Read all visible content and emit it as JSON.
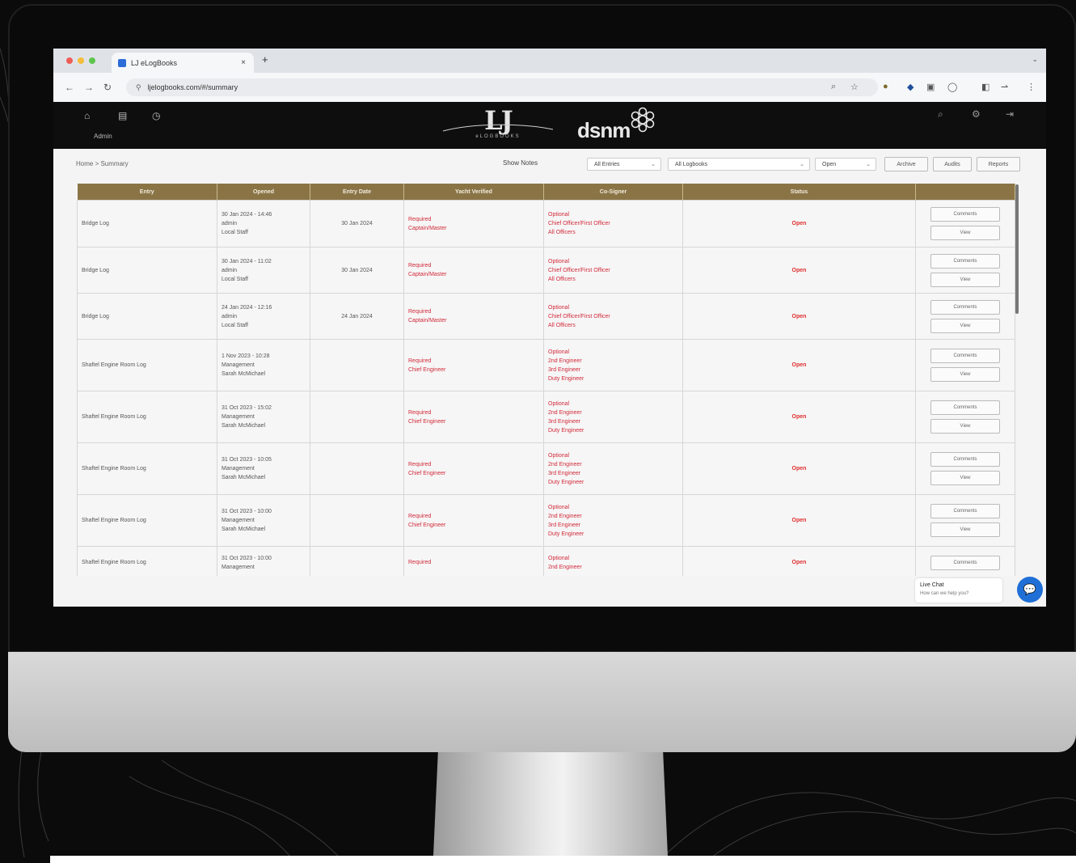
{
  "browser": {
    "tab_title": "LJ eLogBooks",
    "url": "ljelogbooks.com/#/summary"
  },
  "header": {
    "admin_label": "Admin",
    "logo_lj_sub": "eLOGBOOKS",
    "logo_dsnm": "dsnm"
  },
  "toolbar": {
    "breadcrumb": "Home > Summary",
    "show_notes": "Show Notes",
    "filter_entries": "All Entries",
    "filter_logbooks": "All Logbooks",
    "filter_status": "Open",
    "btn_archive": "Archive",
    "btn_audits": "Audits",
    "btn_reports": "Reports"
  },
  "table": {
    "headers": [
      "Entry",
      "Opened",
      "Entry Date",
      "Yacht Verified",
      "Co-Signer",
      "Status",
      ""
    ],
    "rows": [
      {
        "entry": "Bridge Log",
        "opened": [
          "30 Jan 2024 - 14:46",
          "admin",
          "Local Staff"
        ],
        "date": "30 Jan 2024",
        "verified": [
          "Required",
          "Captain/Master"
        ],
        "cosign": [
          "Optional",
          "Chief Officer/First Officer",
          "All Officers"
        ],
        "status": "Open",
        "btn1": "Comments",
        "btn2": "View"
      },
      {
        "entry": "Bridge Log",
        "opened": [
          "30 Jan 2024 - 11:02",
          "admin",
          "Local Staff"
        ],
        "date": "30 Jan 2024",
        "verified": [
          "Required",
          "Captain/Master"
        ],
        "cosign": [
          "Optional",
          "Chief Officer/First Officer",
          "All Officers"
        ],
        "status": "Open",
        "btn1": "Comments",
        "btn2": "View"
      },
      {
        "entry": "Bridge Log",
        "opened": [
          "24 Jan 2024 - 12:16",
          "admin",
          "Local Staff"
        ],
        "date": "24 Jan 2024",
        "verified": [
          "Required",
          "Captain/Master"
        ],
        "cosign": [
          "Optional",
          "Chief Officer/First Officer",
          "All Officers"
        ],
        "status": "Open",
        "btn1": "Comments",
        "btn2": "View"
      },
      {
        "entry": "Shaftel Engine Room Log",
        "opened": [
          "1 Nov 2023 - 10:28",
          "Management",
          "Sarah McMichael"
        ],
        "date": "",
        "verified": [
          "Required",
          "Chief Engineer"
        ],
        "cosign": [
          "Optional",
          "2nd Engineer",
          "3rd Engineer",
          "Duty Engineer"
        ],
        "status": "Open",
        "btn1": "Comments",
        "btn2": "View"
      },
      {
        "entry": "Shaftel Engine Room Log",
        "opened": [
          "31 Oct 2023 - 15:02",
          "Management",
          "Sarah McMichael"
        ],
        "date": "",
        "verified": [
          "Required",
          "Chief Engineer"
        ],
        "cosign": [
          "Optional",
          "2nd Engineer",
          "3rd Engineer",
          "Duty Engineer"
        ],
        "status": "Open",
        "btn1": "Comments",
        "btn2": "View"
      },
      {
        "entry": "Shaftel Engine Room Log",
        "opened": [
          "31 Oct 2023 - 10:05",
          "Management",
          "Sarah McMichael"
        ],
        "date": "",
        "verified": [
          "Required",
          "Chief Engineer"
        ],
        "cosign": [
          "Optional",
          "2nd Engineer",
          "3rd Engineer",
          "Duty Engineer"
        ],
        "status": "Open",
        "btn1": "Comments",
        "btn2": "View"
      },
      {
        "entry": "Shaftel Engine Room Log",
        "opened": [
          "31 Oct 2023 - 10:00",
          "Management",
          "Sarah McMichael"
        ],
        "date": "",
        "verified": [
          "Required",
          "Chief Engineer"
        ],
        "cosign": [
          "Optional",
          "2nd Engineer",
          "3rd Engineer",
          "Duty Engineer"
        ],
        "status": "Open",
        "btn1": "Comments",
        "btn2": "View"
      },
      {
        "entry": "Shaftel Engine Room Log",
        "opened": [
          "31 Oct 2023 - 10:00",
          "Management"
        ],
        "date": "",
        "verified": [
          "Required"
        ],
        "cosign": [
          "Optional",
          "2nd Engineer"
        ],
        "status": "Open",
        "btn1": "Comments",
        "btn2": ""
      }
    ]
  },
  "chat": {
    "title": "Live Chat",
    "subtitle": "How can we help you?"
  },
  "colors": {
    "header_gold": "#8a7446",
    "status_red": "#e03030",
    "link_red": "#d22a3a",
    "chat_blue": "#1f6fd6"
  }
}
